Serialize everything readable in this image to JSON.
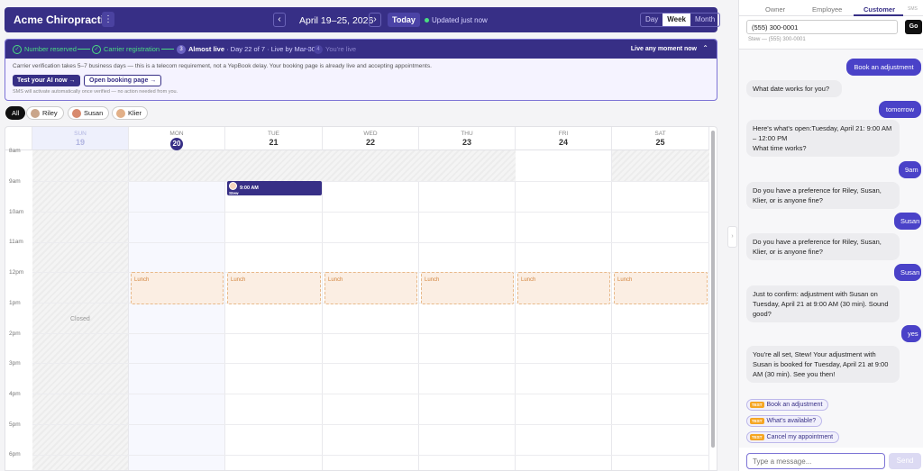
{
  "header": {
    "brand": "Acme Chiropractic",
    "menu_glyph": "⋮",
    "prev_glyph": "‹",
    "next_glyph": "›",
    "date_range": "April 19–25, 2026",
    "today_label": "Today",
    "updated_text": "Updated just now",
    "views": [
      "Day",
      "Week",
      "Month"
    ],
    "active_view": "Week"
  },
  "banner": {
    "steps": [
      {
        "label": "Number reserved",
        "state": "done"
      },
      {
        "label": "Carrier registration",
        "state": "done"
      },
      {
        "num": "3",
        "label": "Almost live",
        "detail": " · Day 22 of 7 · Live by Mar 30",
        "state": "current"
      },
      {
        "num": "4",
        "label": "You're live",
        "state": "pending"
      }
    ],
    "status": "Live any moment now",
    "collapse_glyph": "⌃",
    "note": "Carrier verification takes 5–7 business days — this is a telecom requirement, not a YepBook delay. Your booking page is already live and accepting appointments.",
    "test_button": "Test your AI now →",
    "open_button": "Open booking page →",
    "sms_note": "SMS will activate automatically once verified — no action needed from you."
  },
  "staff_filter": [
    "All",
    "Riley",
    "Susan",
    "Klier"
  ],
  "calendar": {
    "days": [
      {
        "name": "SUN",
        "date": "19"
      },
      {
        "name": "MON",
        "date": "20"
      },
      {
        "name": "TUE",
        "date": "21"
      },
      {
        "name": "WED",
        "date": "22"
      },
      {
        "name": "THU",
        "date": "23"
      },
      {
        "name": "FRI",
        "date": "24"
      },
      {
        "name": "SAT",
        "date": "25"
      }
    ],
    "today": "20",
    "hours": [
      "8am",
      "9am",
      "10am",
      "11am",
      "12pm",
      "1pm",
      "2pm",
      "3pm",
      "4pm",
      "5pm",
      "6pm"
    ],
    "closed_label": "Closed",
    "lunch_label": "Lunch",
    "appointment": {
      "time": "9:00 AM",
      "name": "Stew"
    }
  },
  "panel": {
    "tabs": [
      "Owner",
      "Employee",
      "Customer"
    ],
    "active_tab": "Customer",
    "sms_tag": "SMS",
    "phone_value": "(555) 300-0001",
    "go_label": "Go",
    "customer_line": "Stew — (555) 300-0001",
    "handle_glyph": "›",
    "messages": [
      {
        "from": "customer",
        "text": "Book an adjustment"
      },
      {
        "from": "ai",
        "text": "What date works for you?"
      },
      {
        "from": "customer",
        "text": "tomorrow"
      },
      {
        "from": "ai",
        "text": "Here's what's open:Tuesday, April 21: 9:00 AM – 12:00 PM\nWhat time works?"
      },
      {
        "from": "customer",
        "text": "9am"
      },
      {
        "from": "ai",
        "text": "Do you have a preference for Riley, Susan, Klier, or is anyone fine?"
      },
      {
        "from": "customer",
        "text": "Susan"
      },
      {
        "from": "ai",
        "text": "Do you have a preference for Riley, Susan, Klier, or is anyone fine?"
      },
      {
        "from": "customer",
        "text": "Susan"
      },
      {
        "from": "ai",
        "text": "Just to confirm: adjustment with Susan on Tuesday, April 21 at 9:00 AM (30 min). Sound good?"
      },
      {
        "from": "customer",
        "text": "yes"
      },
      {
        "from": "ai",
        "text": "You're all set, Stew! Your adjustment with Susan is booked for Tuesday, April 21 at 9:00 AM (30 min). See you then!"
      }
    ],
    "test_tag": "TEST",
    "quick_replies": [
      "Book an adjustment",
      "What's available?",
      "Cancel my appointment"
    ],
    "composer_placeholder": "Type a message...",
    "send_label": "Send"
  }
}
